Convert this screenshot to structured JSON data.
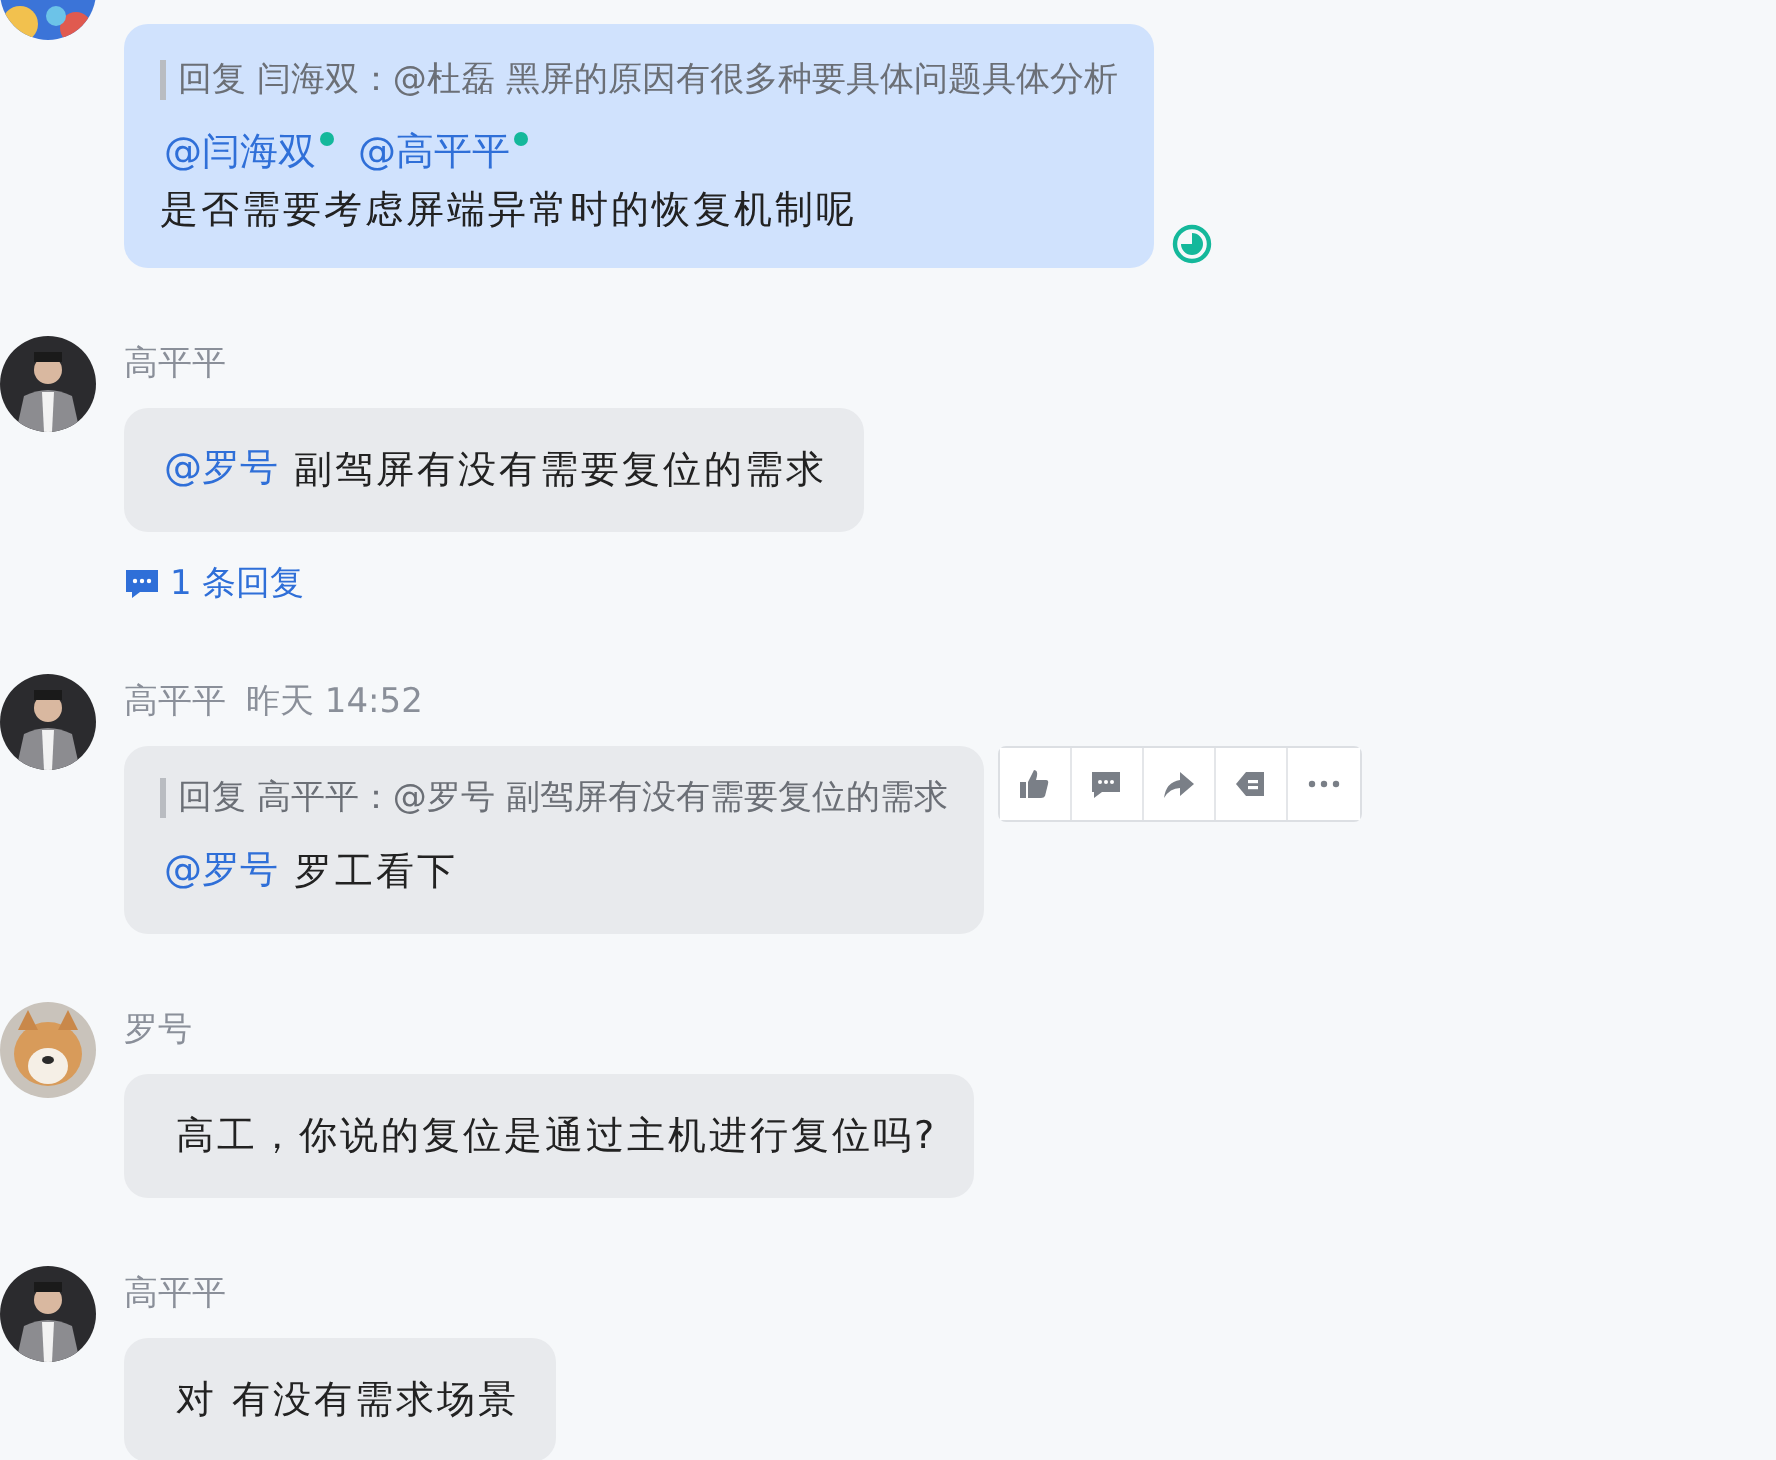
{
  "messages": [
    {
      "quote": "回复 闫海双：@杜磊 黑屏的原因有很多种要具体问题具体分析",
      "mentions": [
        {
          "text": "@闫海双",
          "online": true
        },
        {
          "text": "@高平平",
          "online": true
        }
      ],
      "mentions_on_own_line": true,
      "text": "是否需要考虑屏端异常时的恢复机制呢",
      "own": true,
      "read": true
    },
    {
      "sender": "高平平",
      "mentions": [
        {
          "text": "@罗号",
          "online": false
        }
      ],
      "text": "副驾屏有没有需要复位的需求",
      "replies": "1 条回复"
    },
    {
      "sender": "高平平",
      "time": "昨天 14:52",
      "quote": "回复 高平平：@罗号 副驾屏有没有需要复位的需求",
      "mentions": [
        {
          "text": "@罗号",
          "online": false
        }
      ],
      "text": "罗工看下",
      "show_actions": true
    },
    {
      "sender": "罗号",
      "text": "高工，你说的复位是通过主机进行复位吗?"
    },
    {
      "sender": "高平平",
      "text": "对 有没有需求场景"
    }
  ]
}
